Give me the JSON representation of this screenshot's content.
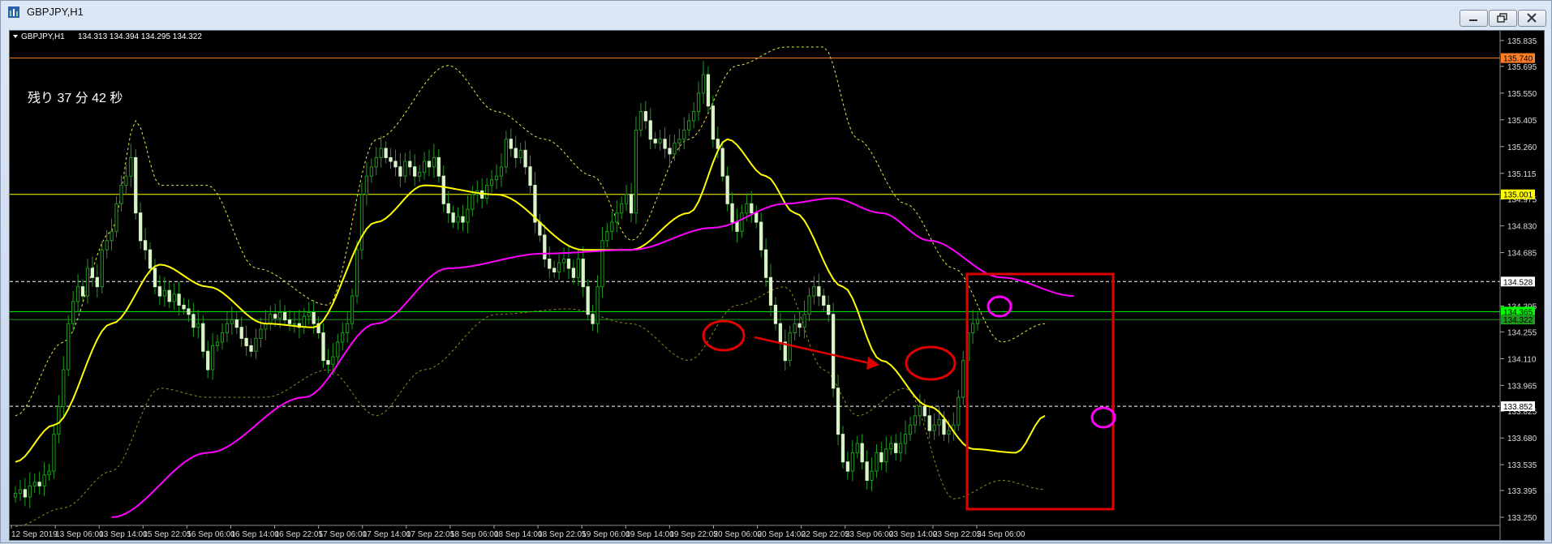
{
  "window": {
    "title": "GBPJPY,H1"
  },
  "chart_header": {
    "symbol_period": "GBPJPY,H1",
    "ohlc": "134.313 134.394 134.295 134.322"
  },
  "countdown": "残り 37 分 42 秒",
  "colors": {
    "background": "#000000",
    "candle_up": "#1e9a1e",
    "candle_down": "#d9f5c8",
    "fast_ma": "#ffff00",
    "slow_ma": "#ff00ff",
    "bollinger": "#e8e84a",
    "lower_band": "#8a8a20",
    "resistance": "#ff7f27",
    "level_yellow": "#ffff00",
    "current_price": "#00ff00",
    "annotation_red": "#e00000",
    "annotation_magenta": "#ff00ff"
  },
  "chart_data": {
    "type": "candlestick",
    "ylim": [
      133.25,
      135.835
    ],
    "y_ticks": [
      "135.835",
      "135.695",
      "135.550",
      "135.405",
      "135.260",
      "135.115",
      "134.975",
      "134.830",
      "134.685",
      "134.395",
      "134.255",
      "134.110",
      "133.965",
      "133.825",
      "133.680",
      "133.535",
      "133.395",
      "133.250"
    ],
    "x_ticks": [
      "12 Sep 2019",
      "13 Sep 06:00",
      "13 Sep 14:00",
      "15 Sep 22:05",
      "16 Sep 06:00",
      "16 Sep 14:00",
      "16 Sep 22:05",
      "17 Sep 06:00",
      "17 Sep 14:00",
      "17 Sep 22:05",
      "18 Sep 06:00",
      "18 Sep 14:00",
      "18 Sep 22:05",
      "19 Sep 06:00",
      "19 Sep 14:00",
      "19 Sep 22:05",
      "20 Sep 06:00",
      "20 Sep 14:00",
      "22 Sep 22:05",
      "23 Sep 06:00",
      "23 Sep 14:00",
      "23 Sep 22:05",
      "24 Sep 06:00"
    ],
    "closes": [
      133.38,
      133.4,
      133.36,
      133.42,
      133.44,
      133.42,
      133.48,
      133.5,
      133.7,
      133.85,
      134.05,
      134.3,
      134.42,
      134.5,
      134.45,
      134.6,
      134.55,
      134.5,
      134.7,
      134.75,
      134.8,
      134.95,
      135.05,
      135.1,
      135.2,
      134.9,
      134.75,
      134.7,
      134.6,
      134.5,
      134.45,
      134.48,
      134.42,
      134.46,
      134.4,
      134.38,
      134.35,
      134.28,
      134.3,
      134.15,
      134.05,
      134.18,
      134.2,
      134.25,
      134.3,
      134.32,
      134.28,
      134.22,
      134.18,
      134.15,
      134.22,
      134.27,
      134.3,
      134.35,
      134.33,
      134.36,
      134.32,
      134.3,
      134.3,
      134.28,
      134.34,
      134.36,
      134.3,
      134.25,
      134.1,
      134.08,
      134.12,
      134.2,
      134.25,
      134.3,
      134.45,
      134.7,
      135.0,
      135.1,
      135.15,
      135.2,
      135.25,
      135.2,
      135.18,
      135.15,
      135.1,
      135.18,
      135.15,
      135.1,
      135.12,
      135.18,
      135.15,
      135.2,
      135.1,
      134.95,
      134.9,
      134.85,
      134.88,
      134.85,
      134.92,
      135.0,
      135.02,
      134.98,
      135.05,
      135.08,
      135.1,
      135.15,
      135.3,
      135.25,
      135.2,
      135.24,
      135.15,
      135.05,
      134.85,
      134.78,
      134.65,
      134.6,
      134.58,
      134.63,
      134.65,
      134.6,
      134.55,
      134.65,
      134.5,
      134.35,
      134.3,
      134.5,
      134.75,
      134.8,
      134.85,
      134.9,
      134.95,
      135.0,
      134.9,
      135.35,
      135.45,
      135.4,
      135.3,
      135.28,
      135.3,
      135.25,
      135.22,
      135.28,
      135.3,
      135.35,
      135.4,
      135.45,
      135.55,
      135.65,
      135.48,
      135.3,
      135.25,
      135.1,
      134.95,
      134.85,
      134.8,
      134.9,
      134.95,
      134.9,
      134.85,
      134.7,
      134.55,
      134.4,
      134.3,
      134.2,
      134.1,
      134.25,
      134.3,
      134.28,
      134.35,
      134.45,
      134.5,
      134.45,
      134.4,
      134.35,
      133.95,
      133.7,
      133.55,
      133.5,
      133.6,
      133.65,
      133.55,
      133.45,
      133.5,
      133.6,
      133.55,
      133.62,
      133.65,
      133.6,
      133.65,
      133.7,
      133.75,
      133.8,
      133.85,
      133.8,
      133.72,
      133.75,
      133.78,
      133.7,
      133.72,
      133.75,
      133.9,
      134.1,
      134.25,
      134.3,
      134.322
    ],
    "fast_ma_anchors": [
      [
        0,
        133.55
      ],
      [
        8,
        133.75
      ],
      [
        20,
        134.3
      ],
      [
        30,
        134.62
      ],
      [
        40,
        134.5
      ],
      [
        52,
        134.3
      ],
      [
        62,
        134.28
      ],
      [
        75,
        134.85
      ],
      [
        85,
        135.05
      ],
      [
        100,
        135.0
      ],
      [
        118,
        134.7
      ],
      [
        128,
        134.7
      ],
      [
        140,
        134.9
      ],
      [
        148,
        135.3
      ],
      [
        156,
        135.1
      ],
      [
        162,
        134.9
      ],
      [
        172,
        134.5
      ],
      [
        180,
        134.1
      ],
      [
        190,
        133.85
      ],
      [
        199,
        133.62
      ],
      [
        208,
        133.6
      ],
      [
        214,
        133.8
      ]
    ],
    "slow_ma_anchors": [
      [
        20,
        133.25
      ],
      [
        40,
        133.6
      ],
      [
        60,
        133.9
      ],
      [
        75,
        134.3
      ],
      [
        90,
        134.6
      ],
      [
        110,
        134.68
      ],
      [
        128,
        134.7
      ],
      [
        145,
        134.82
      ],
      [
        160,
        134.95
      ],
      [
        170,
        134.98
      ],
      [
        180,
        134.9
      ],
      [
        190,
        134.75
      ],
      [
        205,
        134.55
      ],
      [
        220,
        134.45
      ]
    ],
    "upper_band_anchors": [
      [
        0,
        133.8
      ],
      [
        10,
        134.2
      ],
      [
        20,
        134.8
      ],
      [
        25,
        135.4
      ],
      [
        30,
        135.05
      ],
      [
        40,
        135.05
      ],
      [
        50,
        134.6
      ],
      [
        65,
        134.4
      ],
      [
        75,
        135.3
      ],
      [
        90,
        135.7
      ],
      [
        100,
        135.45
      ],
      [
        110,
        135.3
      ],
      [
        120,
        135.1
      ],
      [
        128,
        134.75
      ],
      [
        140,
        135.3
      ],
      [
        150,
        135.7
      ],
      [
        160,
        135.8
      ],
      [
        168,
        135.8
      ],
      [
        175,
        135.3
      ],
      [
        185,
        134.95
      ],
      [
        195,
        134.6
      ],
      [
        205,
        134.2
      ],
      [
        214,
        134.3
      ]
    ],
    "lower_band_anchors": [
      [
        0,
        133.2
      ],
      [
        10,
        133.3
      ],
      [
        20,
        133.5
      ],
      [
        30,
        133.95
      ],
      [
        40,
        133.9
      ],
      [
        52,
        133.9
      ],
      [
        65,
        134.05
      ],
      [
        75,
        133.8
      ],
      [
        85,
        134.05
      ],
      [
        100,
        134.35
      ],
      [
        115,
        134.38
      ],
      [
        128,
        134.3
      ],
      [
        140,
        134.1
      ],
      [
        150,
        134.4
      ],
      [
        160,
        134.5
      ],
      [
        168,
        134.05
      ],
      [
        175,
        133.8
      ],
      [
        185,
        133.95
      ],
      [
        195,
        133.35
      ],
      [
        205,
        133.45
      ],
      [
        214,
        133.4
      ]
    ],
    "levels": [
      {
        "label": "135.740",
        "value": 135.74,
        "style": "solid",
        "color": "#ff7f27"
      },
      {
        "label": "135.001",
        "value": 135.001,
        "style": "solid",
        "color": "#ffff00"
      },
      {
        "label": "134.528",
        "value": 134.528,
        "style": "dashed",
        "color": "#ffffff"
      },
      {
        "label": "134.365",
        "value": 134.365,
        "style": "solid",
        "color": "#00ff00"
      },
      {
        "label": "134.322",
        "value": 134.322,
        "style": "solid",
        "color": "#1e9a1e"
      },
      {
        "label": "133.852",
        "value": 133.852,
        "style": "dashed",
        "color": "#ffffff"
      }
    ]
  }
}
